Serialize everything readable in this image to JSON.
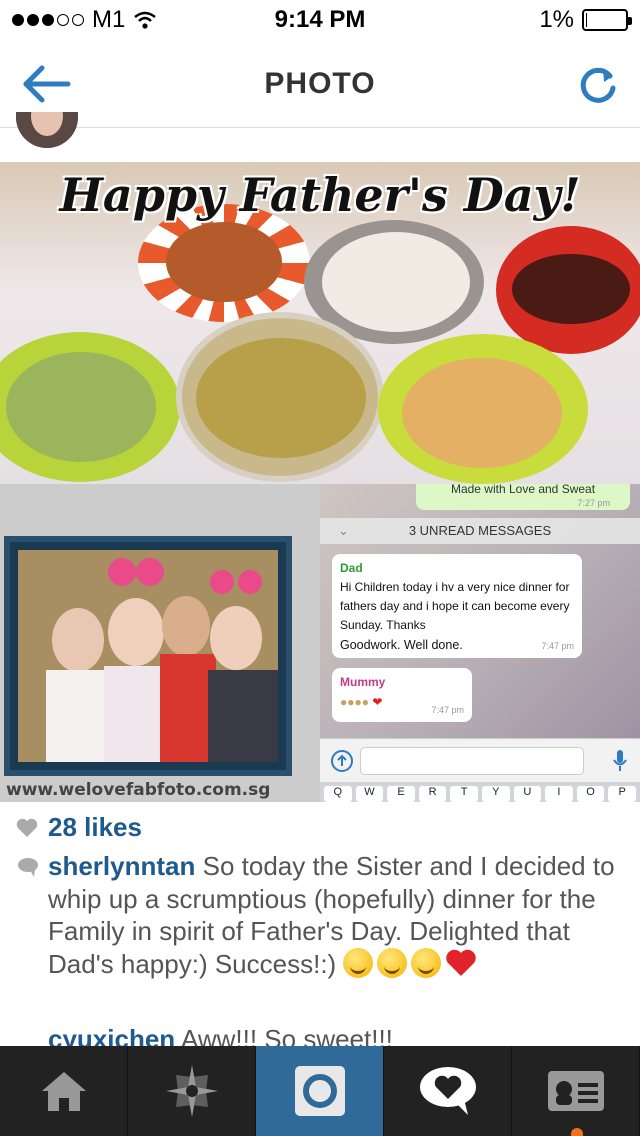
{
  "status_bar": {
    "carrier": "M1",
    "time": "9:14 PM",
    "battery_percent": "1%",
    "battery_level": 0.01,
    "signal_bars": 3
  },
  "nav": {
    "title": "PHOTO",
    "back_icon": "arrow-left-icon",
    "refresh_icon": "refresh-icon",
    "accent": "#3a8bc9"
  },
  "photo": {
    "title": "Happy Father's Day!",
    "booth_url": "www.welovefabfoto.com.sg",
    "chat": {
      "top_bubble": "Made with Love and Sweat",
      "top_bubble_time": "7:27 pm",
      "unread": "3 UNREAD MESSAGES",
      "dad_name": "Dad",
      "dad_message": "Hi Children today i hv a very nice dinner for fathers day and i hope it can become every Sunday. Thanks",
      "dad_message2": "Goodwork. Well done.",
      "dad_time": "7:47 pm",
      "mummy_name": "Mummy",
      "mummy_time": "7:47 pm",
      "keyboard_keys": [
        "Q",
        "W",
        "E",
        "R",
        "T",
        "Y",
        "U",
        "I",
        "O",
        "P"
      ]
    }
  },
  "likes": {
    "text": "28 likes",
    "icon": "heart-icon"
  },
  "caption": {
    "username": "sherlynntan",
    "text": "So today the Sister and I decided to whip up a scrumptious (hopefully) dinner for the Family in spirit of Father's Day. Delighted that Dad's happy:) Success!:)",
    "icon": "comment-bubble-icon"
  },
  "comment": {
    "username": "cyuxichen",
    "text": "Aww!!! So sweet!!!"
  },
  "tab_bar": {
    "items": [
      {
        "name": "home",
        "icon": "home-icon"
      },
      {
        "name": "explore",
        "icon": "explore-star-icon"
      },
      {
        "name": "camera",
        "icon": "camera-icon"
      },
      {
        "name": "news",
        "icon": "heart-bubble-icon"
      },
      {
        "name": "profile",
        "icon": "profile-card-icon"
      }
    ],
    "active_index": 2,
    "active_color": "#2f6a99"
  }
}
